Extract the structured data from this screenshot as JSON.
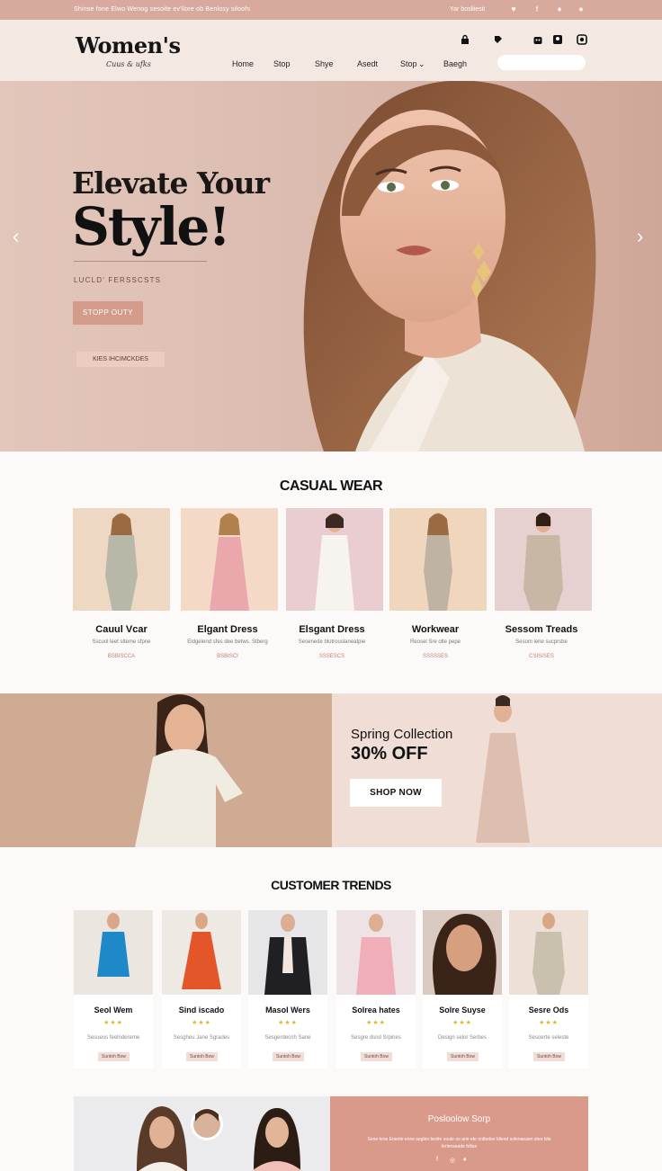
{
  "topbar": {
    "promo": "Shinse fone Elwo Wenog sesoite ev'llore ob Benlosy siloofs",
    "account": "Yar bosliiesit",
    "icons": [
      "heart-icon",
      "facebook-icon",
      "twitter-icon",
      "instagram-icon"
    ]
  },
  "header": {
    "logo": "Women's",
    "tagline": "Cuus & ufks",
    "nav": [
      "Home",
      "Stop",
      "Shye",
      "Asedt",
      "Stop",
      "Baegh"
    ],
    "nav_dropdown_glyph": "⌄",
    "icons": [
      "lock-icon",
      "tag-icon",
      "shopping-bag-icon",
      "user-icon",
      "cart-icon"
    ]
  },
  "hero": {
    "title_line1": "Elevate Your",
    "title_line2": "Style!",
    "subtitle": "LUCLD' FERSSCSTS",
    "button_primary": "STOPP OUTY",
    "button_secondary": "KIES IHCIMCKDES",
    "prev_arrow": "‹",
    "next_arrow": "›"
  },
  "casual": {
    "title": "CASUAL WEAR",
    "cards": [
      {
        "name": "Cauul Vcar",
        "desc": "Sscuol leet slteme sfpne",
        "price": "BSBISCCA"
      },
      {
        "name": "Elgant Dress",
        "desc": "Eldgelend sfes dee betws. Stberg",
        "price": "BSBISCI"
      },
      {
        "name": "Elsgant Dress",
        "desc": "Sesenede blotrouslaneatpie",
        "price": "SSSESCS"
      },
      {
        "name": "Workwear",
        "desc": "Reosel Sre olte pepe",
        "price": "SSSSSES"
      },
      {
        "name": "Sessom Treads",
        "desc": "Sesom lene sucprsbe",
        "price": "CSISISES"
      }
    ]
  },
  "promo": {
    "title": "Spring Collection",
    "offer": "30% OFF",
    "button": "SHOP NOW"
  },
  "trends": {
    "title": "CUSTOMER TRENDS",
    "cards": [
      {
        "name": "Seol Wem",
        "stars": "★★★",
        "desc": "Sesueus feelndereme",
        "button": "Suntoh Bow"
      },
      {
        "name": "Sind iscado",
        "stars": "★★★",
        "desc": "Sesgheu Jane Sgrades",
        "button": "Suntoh Bow"
      },
      {
        "name": "Masol Wers",
        "stars": "★★★",
        "desc": "Sesgerdecnh Sane",
        "button": "Suntoh Bow"
      },
      {
        "name": "Solrea hates",
        "stars": "★★★",
        "desc": "Sesgre dsnd Srpines",
        "button": "Suntoh Bow"
      },
      {
        "name": "Solre Suyse",
        "stars": "★★★",
        "desc": "Design selor Serbes",
        "button": "Suntoh Bow"
      },
      {
        "name": "Sesre Ods",
        "stars": "★★★",
        "desc": "Sesoerte seleste",
        "button": "Suntoh Bow"
      }
    ]
  },
  "footer_banner": {
    "title": "Posloolow Sorp",
    "text": "Sene teoe Eoeote enne seglen bedre ooule oo arie ete ontbelee bliend solenaeaen sten bile ferlenseade foliue",
    "social": [
      "facebook-icon",
      "instagram-icon",
      "twitter-icon"
    ]
  },
  "colors": {
    "accent": "#d8a99d",
    "header_bg": "#f4e8e2",
    "button": "#d49b8a",
    "promo_left": "#cfab94",
    "promo_right": "#f0ddd6"
  }
}
